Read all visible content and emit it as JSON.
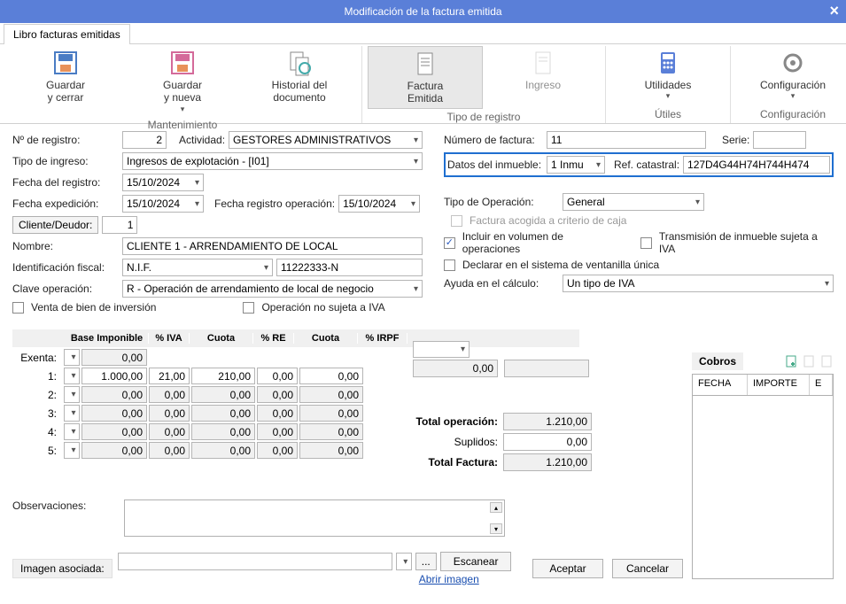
{
  "window": {
    "title": "Modificación de la factura emitida"
  },
  "tab": "Libro facturas emitidas",
  "ribbon": {
    "mantenimiento": {
      "guardar_cerrar": "Guardar\ny cerrar",
      "guardar_nueva": "Guardar\ny nueva",
      "historial": "Historial del\ndocumento",
      "title": "Mantenimiento"
    },
    "tipo_registro": {
      "factura_emitida": "Factura\nEmitida",
      "ingreso": "Ingreso",
      "title": "Tipo de registro"
    },
    "utiles": {
      "utilidades": "Utilidades",
      "title": "Útiles"
    },
    "config": {
      "configuracion": "Configuración",
      "title": "Configuración"
    }
  },
  "labels": {
    "n_registro": "Nº de registro:",
    "actividad": "Actividad:",
    "tipo_ingreso": "Tipo de ingreso:",
    "fecha_registro": "Fecha del registro:",
    "fecha_expedicion": "Fecha expedición:",
    "fecha_reg_op": "Fecha registro operación:",
    "cliente_deudor": "Cliente/Deudor:",
    "nombre": "Nombre:",
    "id_fiscal": "Identificación fiscal:",
    "clave_op": "Clave operación:",
    "venta_bien": "Venta de bien de inversión",
    "op_no_sujeta": "Operación no sujeta a IVA",
    "num_factura": "Número de factura:",
    "serie": "Serie:",
    "datos_inmueble": "Datos del inmueble:",
    "ref_catastral": "Ref. catastral:",
    "tipo_operacion": "Tipo de Operación:",
    "factura_acogida": "Factura acogida a criterio de caja",
    "incluir_volumen": "Incluir en  volumen de operaciones",
    "transmision": "Transmisión de inmueble sujeta a IVA",
    "declarar": "Declarar en el sistema de ventanilla única",
    "ayuda_calculo": "Ayuda en el cálculo:",
    "observaciones": "Observaciones:",
    "imagen_asociada": "Imagen asociada:",
    "escanear": "Escanear",
    "abrir_imagen": "Abrir imagen",
    "aceptar": "Aceptar",
    "cancelar": "Cancelar",
    "dots": "...",
    "cobros": "Cobros"
  },
  "values": {
    "n_registro": "2",
    "actividad": "GESTORES ADMINISTRATIVOS",
    "tipo_ingreso": "Ingresos de explotación - [I01]",
    "fecha_registro": "15/10/2024",
    "fecha_expedicion": "15/10/2024",
    "fecha_reg_op": "15/10/2024",
    "cliente_id": "1",
    "nombre": "CLIENTE 1 - ARRENDAMIENTO DE LOCAL",
    "id_fiscal_tipo": "N.I.F.",
    "id_fiscal_num": "11222333-N",
    "clave_op": "R - Operación de arrendamiento de local de negocio",
    "num_factura": "11",
    "serie": "",
    "inmueble": "1 Inmu",
    "ref_catastral": "127D4G44H74H744H474",
    "tipo_operacion": "General",
    "ayuda_calculo": "Un tipo de IVA",
    "incluir_volumen_checked": true
  },
  "grid": {
    "headers": {
      "base": "Base Imponible",
      "iva": "% IVA",
      "cuota": "Cuota",
      "re": "% RE",
      "cuota2": "Cuota",
      "irpf": "% IRPF"
    },
    "exenta_label": "Exenta:",
    "exenta_value": "0,00",
    "rows": [
      {
        "label": "1:",
        "base": "1.000,00",
        "iva": "21,00",
        "cuota": "210,00",
        "re": "0,00",
        "cuota2": "0,00"
      },
      {
        "label": "2:",
        "base": "0,00",
        "iva": "0,00",
        "cuota": "0,00",
        "re": "0,00",
        "cuota2": "0,00"
      },
      {
        "label": "3:",
        "base": "0,00",
        "iva": "0,00",
        "cuota": "0,00",
        "re": "0,00",
        "cuota2": "0,00"
      },
      {
        "label": "4:",
        "base": "0,00",
        "iva": "0,00",
        "cuota": "0,00",
        "re": "0,00",
        "cuota2": "0,00"
      },
      {
        "label": "5:",
        "base": "0,00",
        "iva": "0,00",
        "cuota": "0,00",
        "re": "0,00",
        "cuota2": "0,00"
      }
    ],
    "irpf_cuota": "0,00"
  },
  "totals": {
    "total_op_label": "Total operación:",
    "total_op": "1.210,00",
    "suplidos_label": "Suplidos:",
    "suplidos": "0,00",
    "total_factura_label": "Total Factura:",
    "total_factura": "1.210,00"
  },
  "cobros_table": {
    "fecha": "FECHA",
    "importe": "IMPORTE",
    "e": "E"
  }
}
